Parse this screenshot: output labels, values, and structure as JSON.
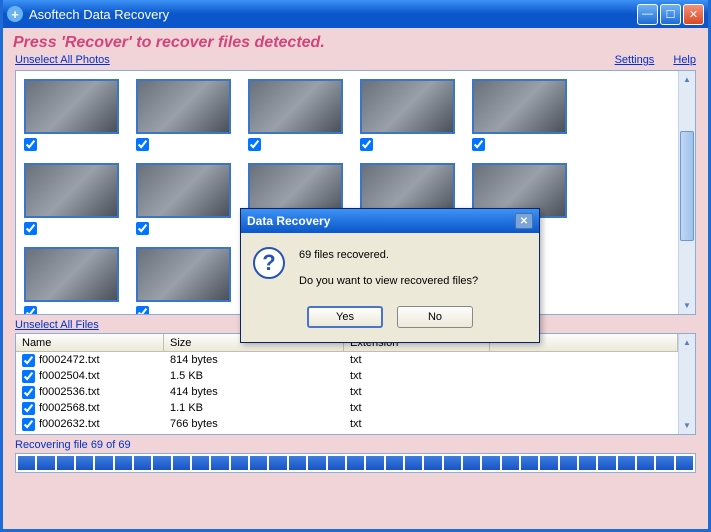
{
  "window": {
    "title": "Asoftech Data Recovery"
  },
  "instruction": "Press 'Recover' to recover files detected.",
  "links": {
    "unselect_photos": "Unselect All Photos",
    "unselect_files": "Unselect All Files",
    "settings": "Settings",
    "help": "Help"
  },
  "files_table": {
    "headers": {
      "name": "Name",
      "size": "Size",
      "ext": "Extension"
    },
    "rows": [
      {
        "name": "f0002472.txt",
        "size": "814 bytes",
        "ext": "txt"
      },
      {
        "name": "f0002504.txt",
        "size": "1.5 KB",
        "ext": "txt"
      },
      {
        "name": "f0002536.txt",
        "size": "414 bytes",
        "ext": "txt"
      },
      {
        "name": "f0002568.txt",
        "size": "1.1 KB",
        "ext": "txt"
      },
      {
        "name": "f0002632.txt",
        "size": "766 bytes",
        "ext": "txt"
      }
    ]
  },
  "status": "Recovering file 69 of 69",
  "dialog": {
    "title": "Data Recovery",
    "line1": "69 files recovered.",
    "line2": "Do you want to view recovered files?",
    "yes": "Yes",
    "no": "No"
  }
}
